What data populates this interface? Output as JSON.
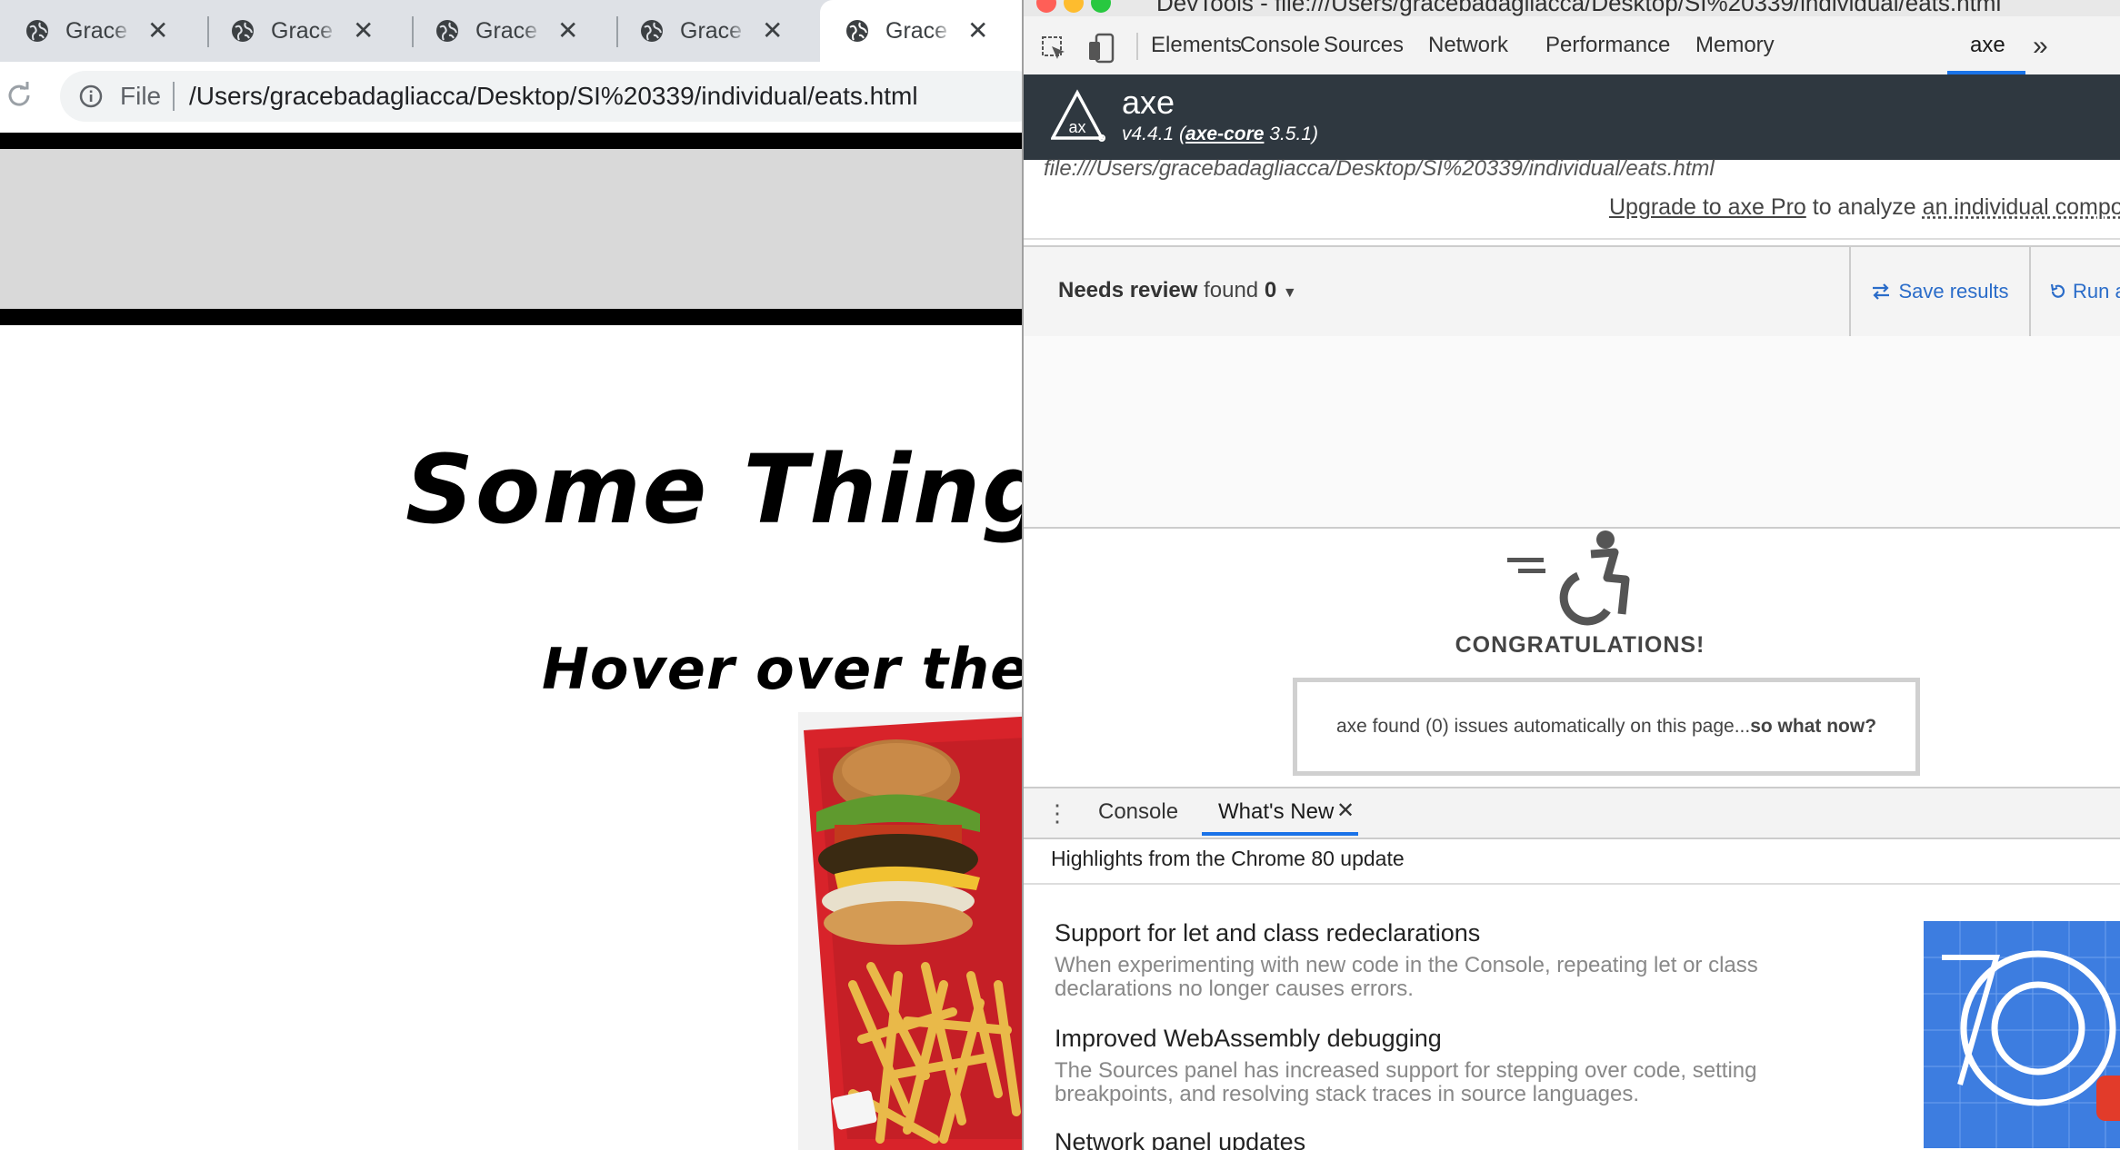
{
  "browser": {
    "tabs": [
      {
        "title": "Grace Badagliacca",
        "active": false
      },
      {
        "title": "Grace Badagliacca",
        "active": false
      },
      {
        "title": "Grace Badagliacca",
        "active": false
      },
      {
        "title": "Grace Badagliacca",
        "active": false
      },
      {
        "title": "Grace Badagliacca",
        "active": true
      }
    ],
    "tab_close_glyph": "✕",
    "address": {
      "scheme_label": "File",
      "url": "/Users/gracebadagliacca/Desktop/SI%20339/individual/eats.html"
    }
  },
  "page": {
    "heading": "Some Thing",
    "subheading": "Hover over the",
    "image_alt": "burger-and-fries-photo"
  },
  "devtools": {
    "window_title": "DevTools - file:///Users/gracebadagliacca/Desktop/SI%20339/individual/eats.html",
    "tabs": [
      "Elements",
      "Console",
      "Sources",
      "Network",
      "Performance",
      "Memory",
      "axe"
    ],
    "active_tab": "axe",
    "more_glyph": "»",
    "accent_color": "#1a73e8"
  },
  "axe": {
    "name": "axe",
    "version": "v4.4.1",
    "core_label": "axe-core",
    "core_version": "3.5.1",
    "scanned_url": "file:///Users/gracebadagliacca/Desktop/SI%20339/individual/eats.html",
    "upgrade_link": "Upgrade to axe Pro",
    "upgrade_text": "to analyze",
    "upgrade_tail": "an individual component",
    "review_label": "Needs review",
    "review_found": "found",
    "review_count": "0",
    "save_label": "Save results",
    "run_label": "Run again",
    "congrats": "CONGRATULATIONS!",
    "issues_text": "axe found (0) issues automatically on this page...",
    "issues_cta": "so what now?",
    "header_bg": "#2f3840",
    "link_color": "#2a6cc9"
  },
  "drawer": {
    "menu_glyph": "⋮",
    "tabs": [
      "Console",
      "What's New"
    ],
    "active_tab": "What's New",
    "close_glyph": "✕",
    "header": "Highlights from the Chrome 80 update",
    "items": [
      {
        "title": "Support for let and class redeclarations",
        "desc": "When experimenting with new code in the Console, repeating let or class declarations no longer causes errors."
      },
      {
        "title": "Improved WebAssembly debugging",
        "desc": "The Sources panel has increased support for stepping over code, setting breakpoints, and resolving stack traces in source languages."
      },
      {
        "title": "Network panel updates",
        "desc": ""
      }
    ]
  }
}
